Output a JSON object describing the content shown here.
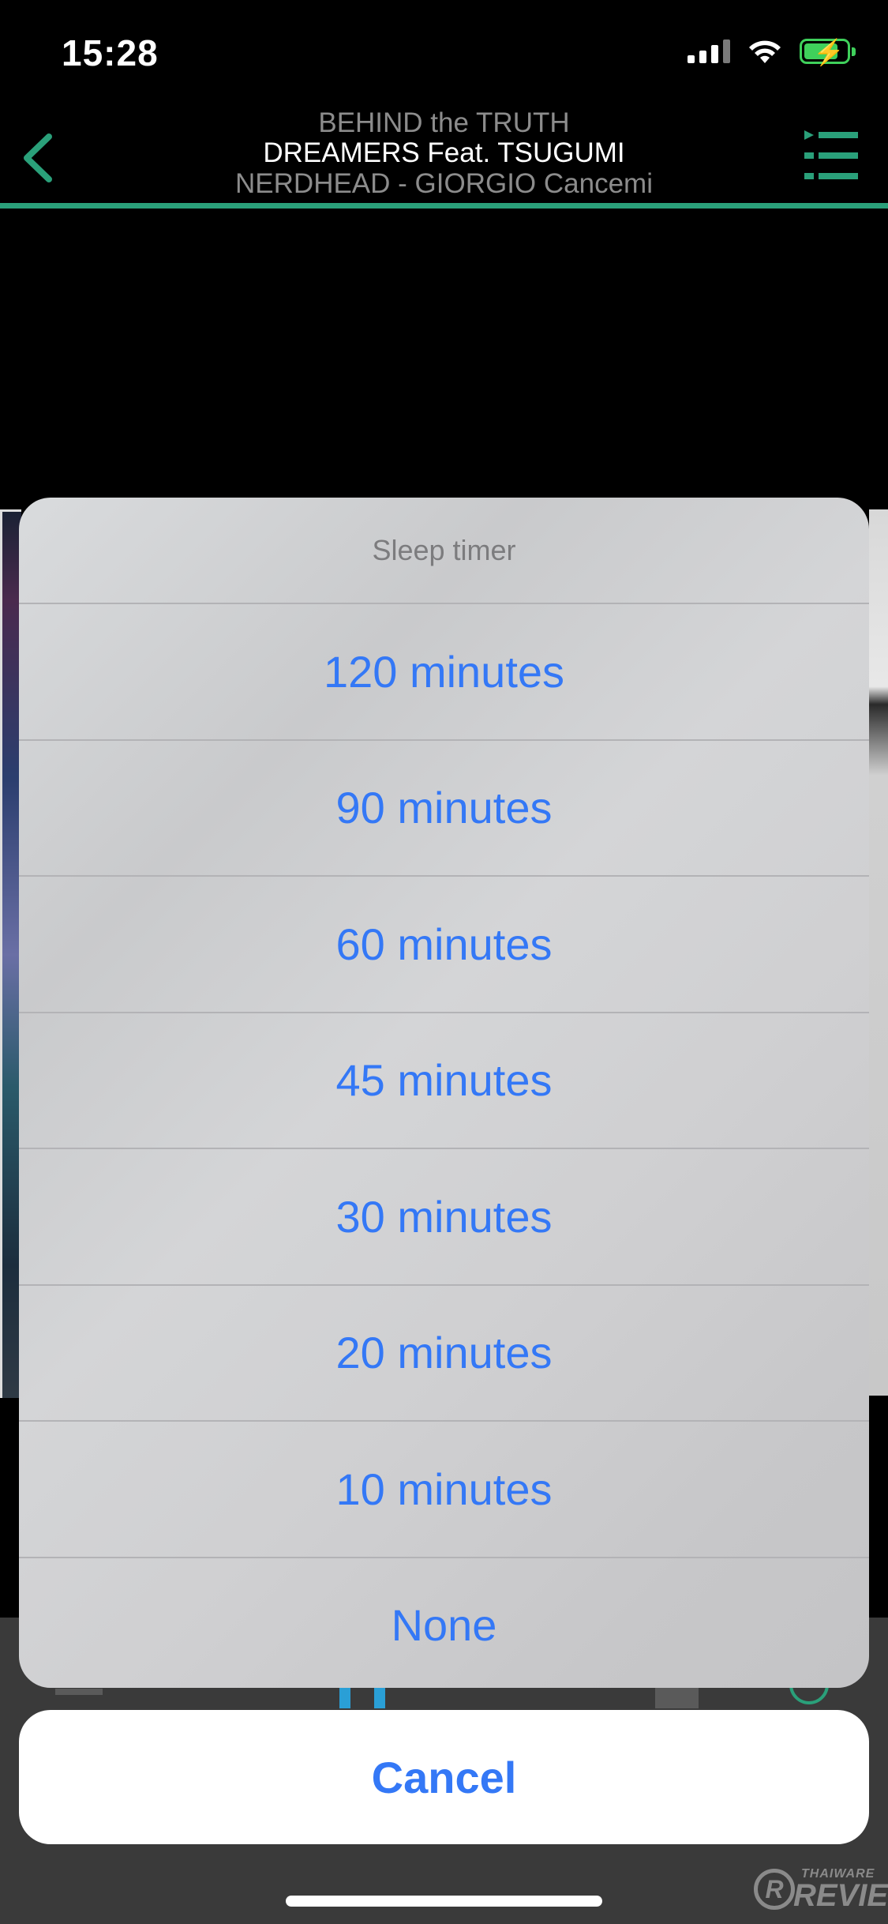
{
  "status_bar": {
    "time": "15:28"
  },
  "header": {
    "album": "BEHIND the TRUTH",
    "title": "DREAMERS Feat. TSUGUMI",
    "artist": "NERDHEAD - GIORGIO Cancemi"
  },
  "sheet": {
    "title": "Sleep timer",
    "options": [
      "120 minutes",
      "90 minutes",
      "60 minutes",
      "45 minutes",
      "30 minutes",
      "20 minutes",
      "10 minutes",
      "None"
    ],
    "cancel_label": "Cancel"
  },
  "watermark": {
    "logo_letter": "R",
    "small": "THAIWARE",
    "big": "REVIEW"
  },
  "colors": {
    "accent": "#2aa07a",
    "action_blue": "#3478f6",
    "battery_green": "#3fd05b"
  },
  "icons": [
    "back-chevron-icon",
    "queue-list-icon",
    "signal-icon",
    "wifi-icon",
    "battery-charging-icon"
  ]
}
